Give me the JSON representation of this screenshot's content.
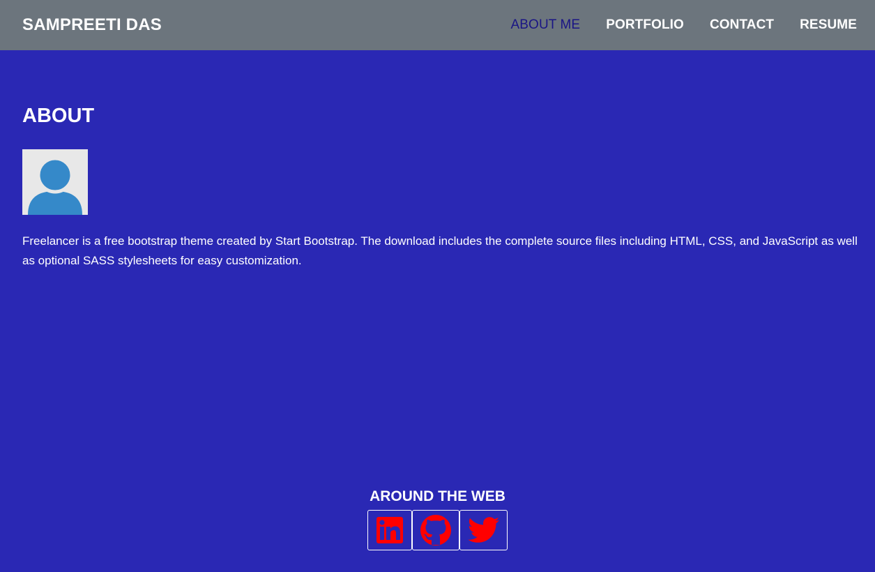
{
  "navbar": {
    "brand": "SAMPREETI DAS",
    "links": [
      {
        "label": "ABOUT ME",
        "active": true
      },
      {
        "label": "PORTFOLIO",
        "active": false
      },
      {
        "label": "CONTACT",
        "active": false
      },
      {
        "label": "RESUME",
        "active": false
      }
    ]
  },
  "about": {
    "title": "ABOUT",
    "avatar_icon": "user-avatar-icon",
    "description": "Freelancer is a free bootstrap theme created by Start Bootstrap. The download includes the complete source files including HTML, CSS, and JavaScript as well as optional SASS stylesheets for easy customization."
  },
  "footer": {
    "title": "AROUND THE WEB",
    "social": [
      {
        "name": "linkedin-icon"
      },
      {
        "name": "github-icon"
      },
      {
        "name": "twitter-icon"
      }
    ]
  },
  "colors": {
    "background": "#2a28b4",
    "navbar": "#6c757d",
    "active_link": "#1a1585",
    "social_icon": "#ff0000",
    "avatar_bg": "#e8e8e8",
    "avatar_figure": "#3589c9"
  }
}
